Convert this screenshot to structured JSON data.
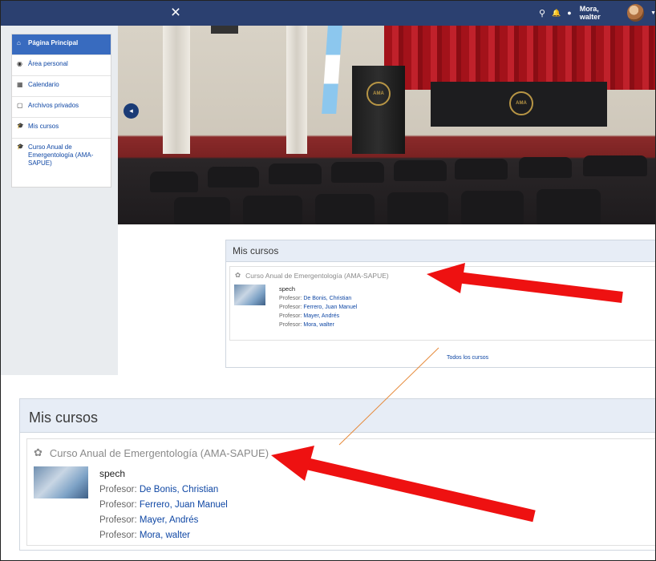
{
  "navbar": {
    "close_icon": "×",
    "search_icon": "⚲",
    "bell_icon": "🔔",
    "chat_icon": "●",
    "user_name": "Mora, walter",
    "caret": "▼"
  },
  "sidebar": {
    "items": [
      {
        "icon": "⌂",
        "label": "Página Principal"
      },
      {
        "icon": "◉",
        "label": "Área personal"
      },
      {
        "icon": "▦",
        "label": "Calendario"
      },
      {
        "icon": "▢",
        "label": "Archivos privados"
      },
      {
        "icon": "🎓",
        "label": "Mis cursos"
      },
      {
        "icon": "🎓",
        "label": "Curso Anual de Emergentología (AMA-SAPUE)"
      }
    ]
  },
  "hero": {
    "emblem": "AMA",
    "arrow": "◂"
  },
  "block": {
    "title": "Mis cursos",
    "course_title": "Curso Anual de Emergentología (AMA-SAPUE)",
    "course_icon": "✿",
    "summary": "spech",
    "profesor_label": "Profesor:",
    "teachers": [
      "De Bonis, Christian",
      "Ferrero, Juan Manuel",
      "Mayer, Andrés",
      "Mora, walter"
    ],
    "all_courses": "Todos los cursos"
  },
  "colors": {
    "navbar": "#2b4070",
    "active": "#386bbf",
    "link": "#0f47a4",
    "arrow": "#ee1111",
    "connector": "#e68a3a"
  }
}
